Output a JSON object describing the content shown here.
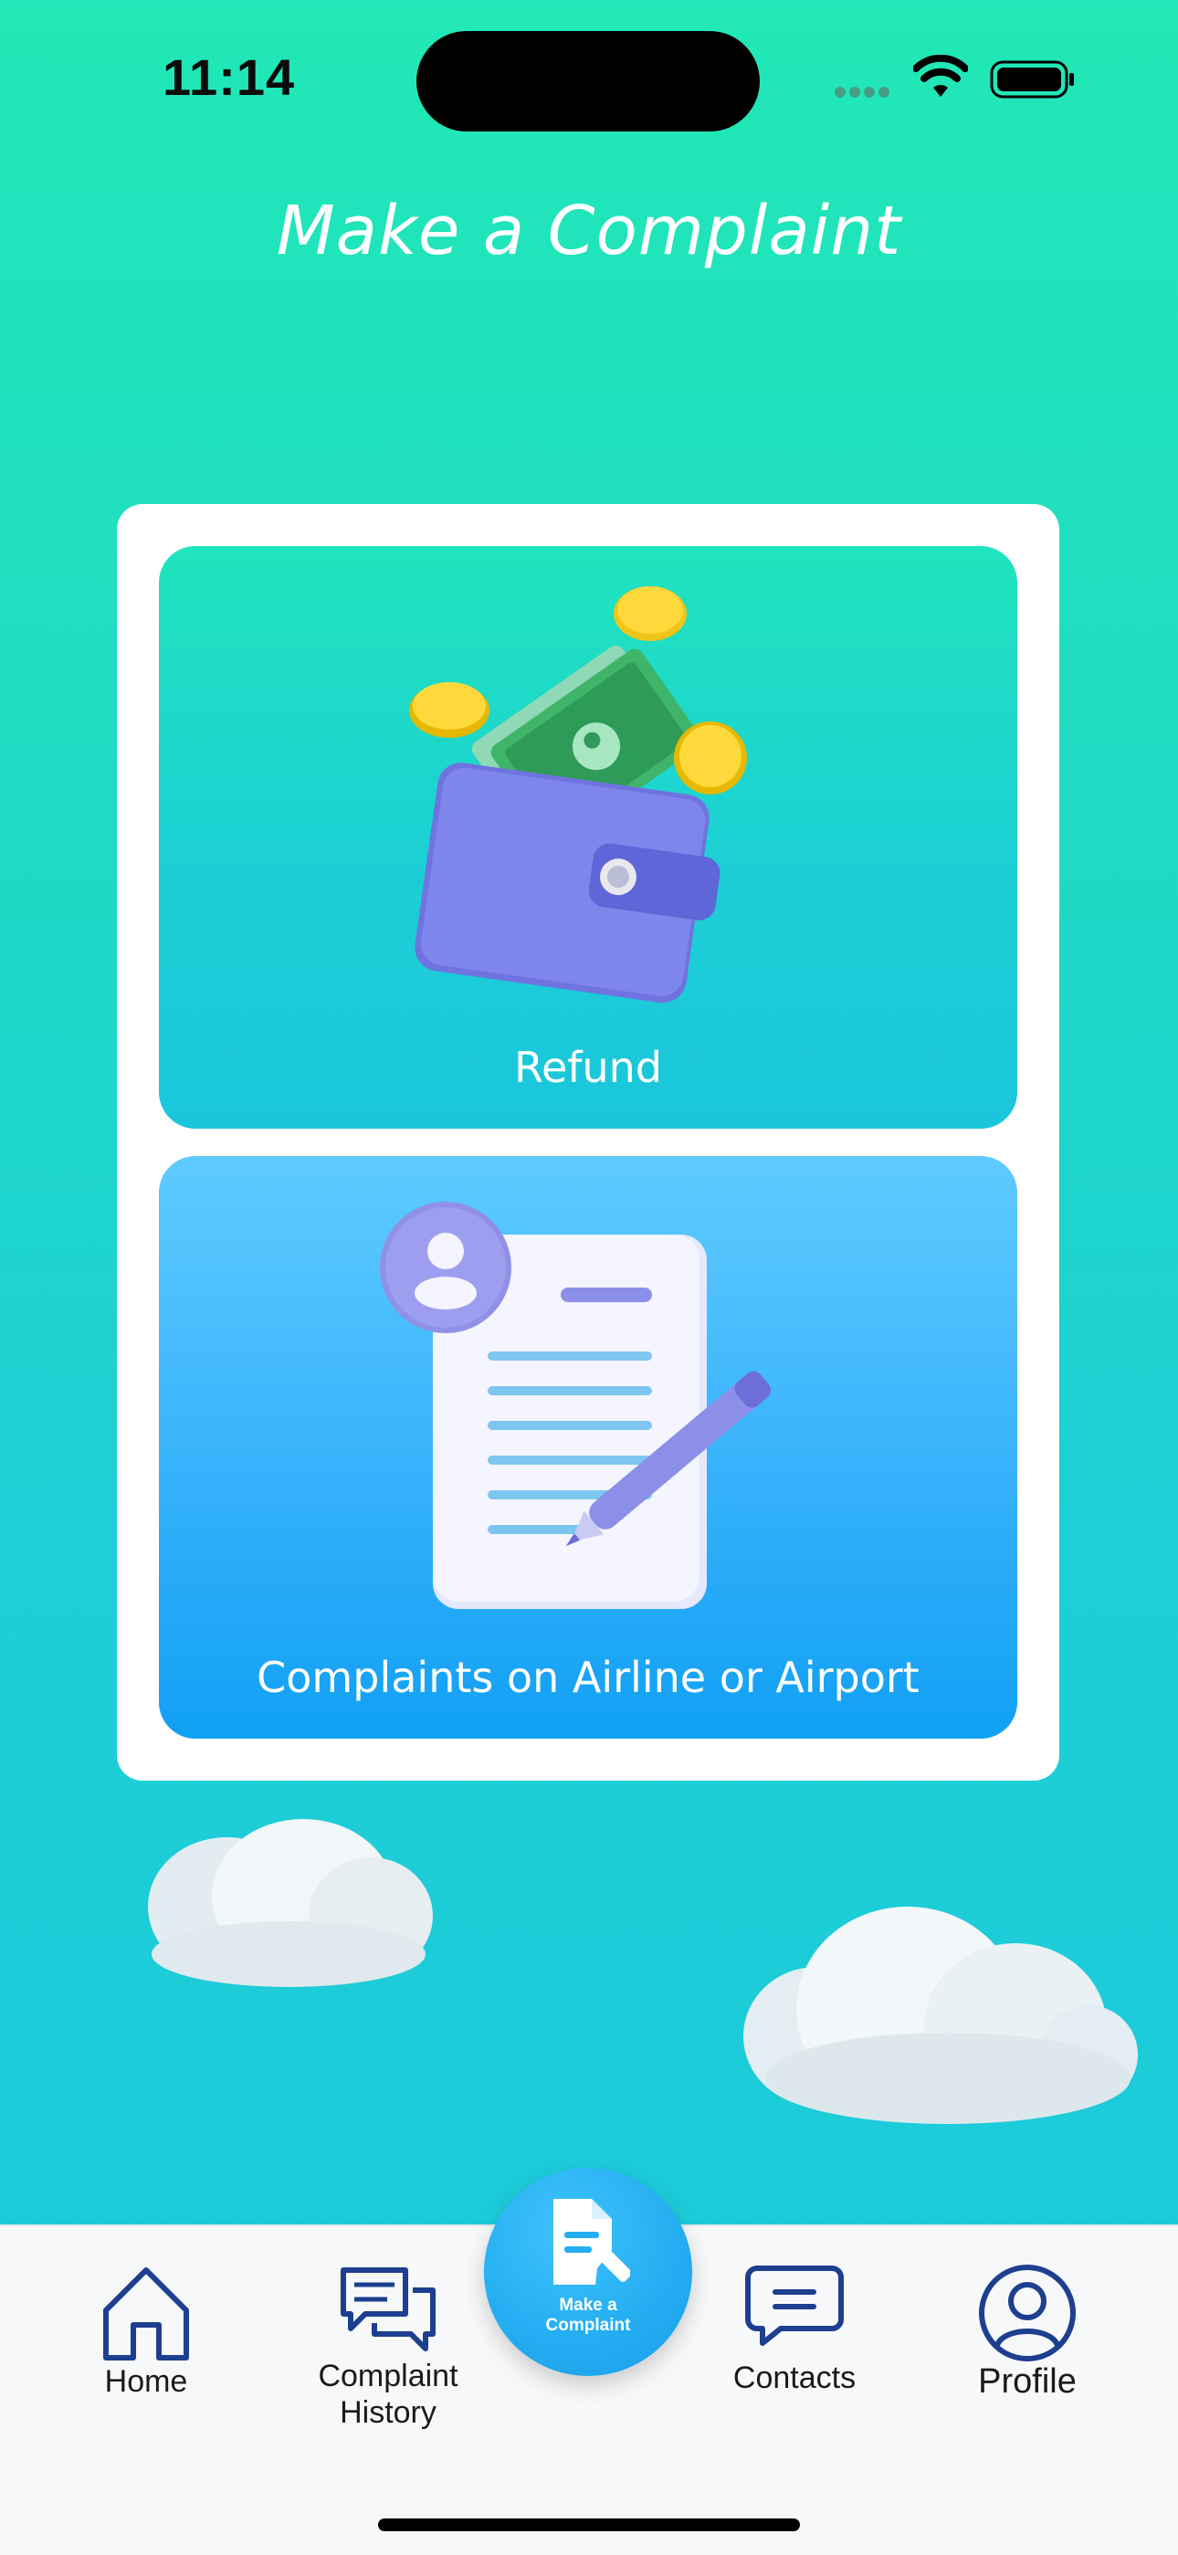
{
  "status_bar": {
    "time": "11:14"
  },
  "header": {
    "title": "Make a Complaint"
  },
  "options": [
    {
      "label": "Refund",
      "icon": "wallet-cash-icon"
    },
    {
      "label": "Complaints on Airline or Airport",
      "icon": "document-pen-icon"
    }
  ],
  "tab_bar": {
    "home": "Home",
    "history_line1": "Complaint",
    "history_line2": "History",
    "center_line1": "Make a",
    "center_line2": "Complaint",
    "contacts": "Contacts",
    "profile": "Profile"
  },
  "colors": {
    "accent": "#1ee3b9",
    "tab_icon": "#1d3f8f",
    "center_button": "#25aef2"
  }
}
